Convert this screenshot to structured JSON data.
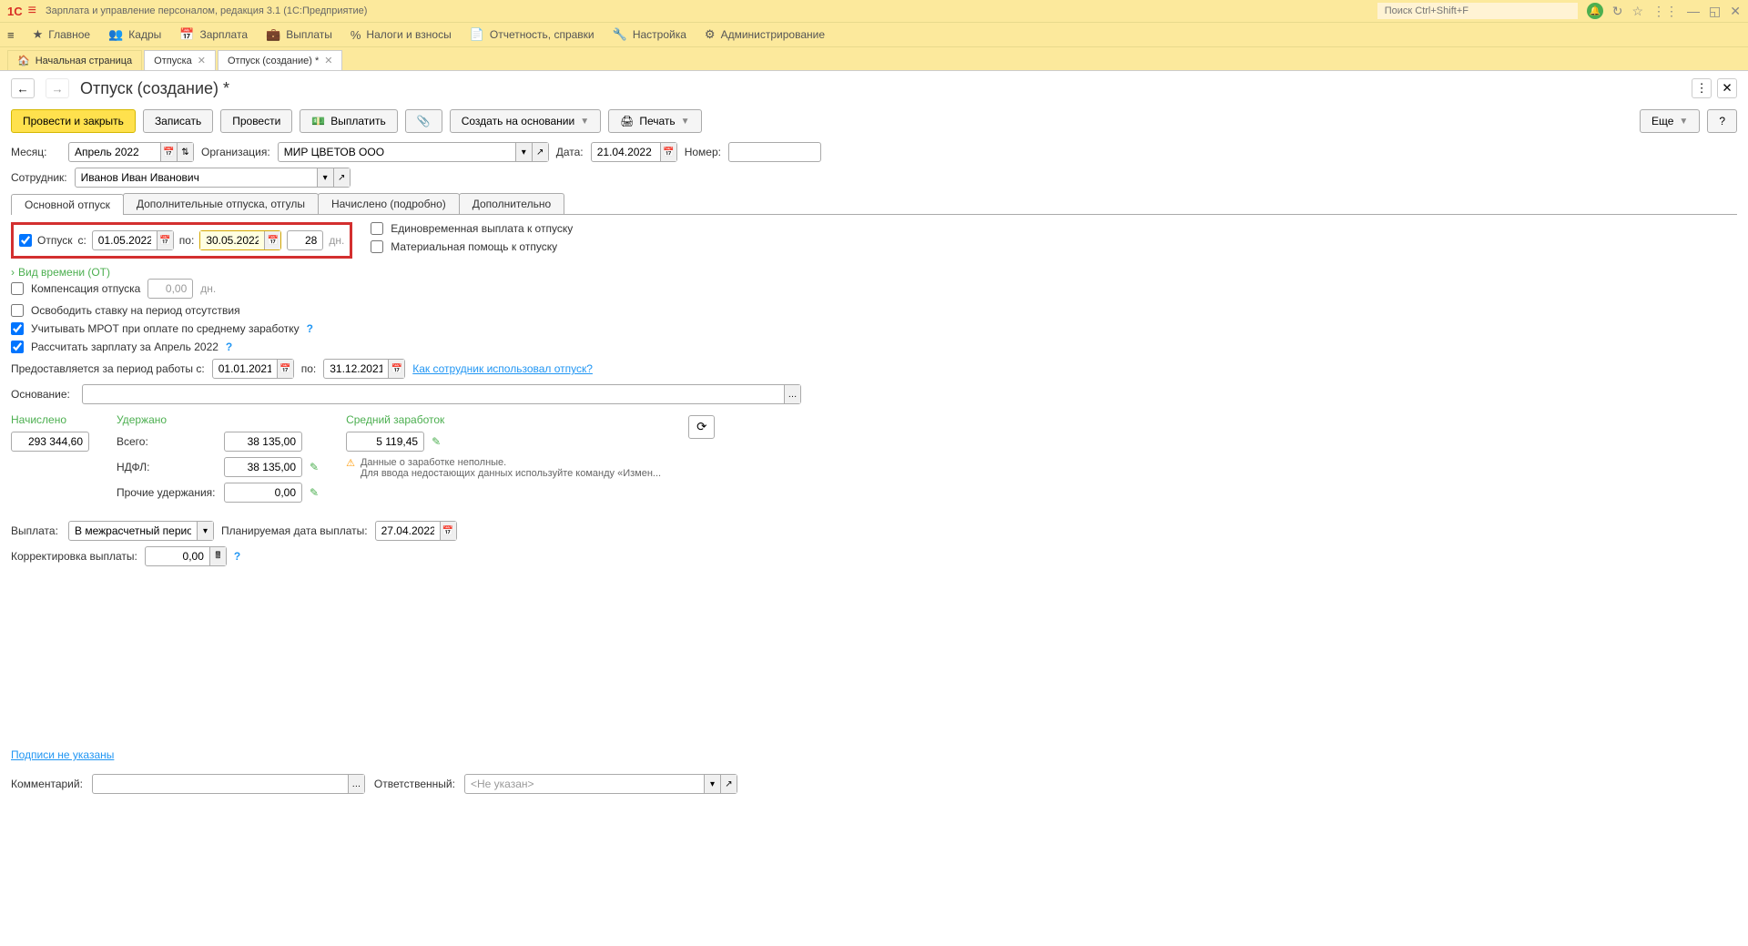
{
  "app": {
    "logo_text": "1C",
    "title": "Зарплата и управление персоналом, редакция 3.1  (1С:Предприятие)",
    "search_placeholder": "Поиск Ctrl+Shift+F"
  },
  "mainmenu": {
    "items": [
      {
        "icon": "star",
        "label": "Главное"
      },
      {
        "icon": "people",
        "label": "Кадры"
      },
      {
        "icon": "calendar",
        "label": "Зарплата"
      },
      {
        "icon": "wallet",
        "label": "Выплаты"
      },
      {
        "icon": "percent",
        "label": "Налоги и взносы"
      },
      {
        "icon": "doc",
        "label": "Отчетность, справки"
      },
      {
        "icon": "wrench",
        "label": "Настройка"
      },
      {
        "icon": "gear",
        "label": "Администрирование"
      }
    ]
  },
  "tabs": {
    "home": "Начальная страница",
    "items": [
      {
        "label": "Отпуска"
      },
      {
        "label": "Отпуск (создание) *",
        "active": true
      }
    ]
  },
  "page": {
    "title": "Отпуск (создание) *"
  },
  "toolbar": {
    "post_close": "Провести и закрыть",
    "save": "Записать",
    "post": "Провести",
    "pay": "Выплатить",
    "create_based": "Создать на основании",
    "print": "Печать",
    "more": "Еще",
    "help": "?"
  },
  "form": {
    "month_lbl": "Месяц:",
    "month": "Апрель 2022",
    "org_lbl": "Организация:",
    "org": "МИР ЦВЕТОВ ООО",
    "date_lbl": "Дата:",
    "date": "21.04.2022",
    "number_lbl": "Номер:",
    "number": "",
    "employee_lbl": "Сотрудник:",
    "employee": "Иванов Иван Иванович"
  },
  "subtabs": [
    "Основной отпуск",
    "Дополнительные отпуска, отгулы",
    "Начислено (подробно)",
    "Дополнительно"
  ],
  "vac": {
    "chk_label": "Отпуск",
    "from_lbl": "с:",
    "from": "01.05.2022",
    "to_lbl": "по:",
    "to": "30.05.2022",
    "days": "28",
    "days_suffix": "дн.",
    "time_type": "Вид времени (ОТ)",
    "onetime": "Единовременная выплата к отпуску",
    "mat_help": "Материальная помощь к отпуску",
    "compensation": "Компенсация отпуска",
    "comp_days": "0,00",
    "comp_suffix": "дн.",
    "free_rate": "Освободить ставку на период отсутствия",
    "mrot": "Учитывать МРОТ при оплате по среднему заработку",
    "calc_salary": "Рассчитать зарплату за Апрель 2022",
    "period_lbl": "Предоставляется за период работы с:",
    "period_from": "01.01.2021",
    "period_to_lbl": "по:",
    "period_to": "31.12.2021",
    "how_used": "Как сотрудник использовал отпуск?",
    "basis_lbl": "Основание:"
  },
  "totals": {
    "accrued_lbl": "Начислено",
    "accrued": "293 344,60",
    "withheld_lbl": "Удержано",
    "withheld_total_lbl": "Всего:",
    "withheld_total": "38 135,00",
    "ndfl_lbl": "НДФЛ:",
    "ndfl": "38 135,00",
    "other_lbl": "Прочие удержания:",
    "other": "0,00",
    "avg_lbl": "Средний заработок",
    "avg": "5 119,45",
    "warn_line1": "Данные о заработке неполные.",
    "warn_line2": "Для ввода недостающих данных используйте команду «Измен..."
  },
  "payout": {
    "lbl": "Выплата:",
    "value": "В межрасчетный период",
    "plan_lbl": "Планируемая дата выплаты:",
    "plan_date": "27.04.2022",
    "corr_lbl": "Корректировка выплаты:",
    "corr": "0,00"
  },
  "footer": {
    "signs": "Подписи не указаны",
    "comment_lbl": "Комментарий:",
    "resp_lbl": "Ответственный:",
    "resp": "<Не указан>"
  }
}
